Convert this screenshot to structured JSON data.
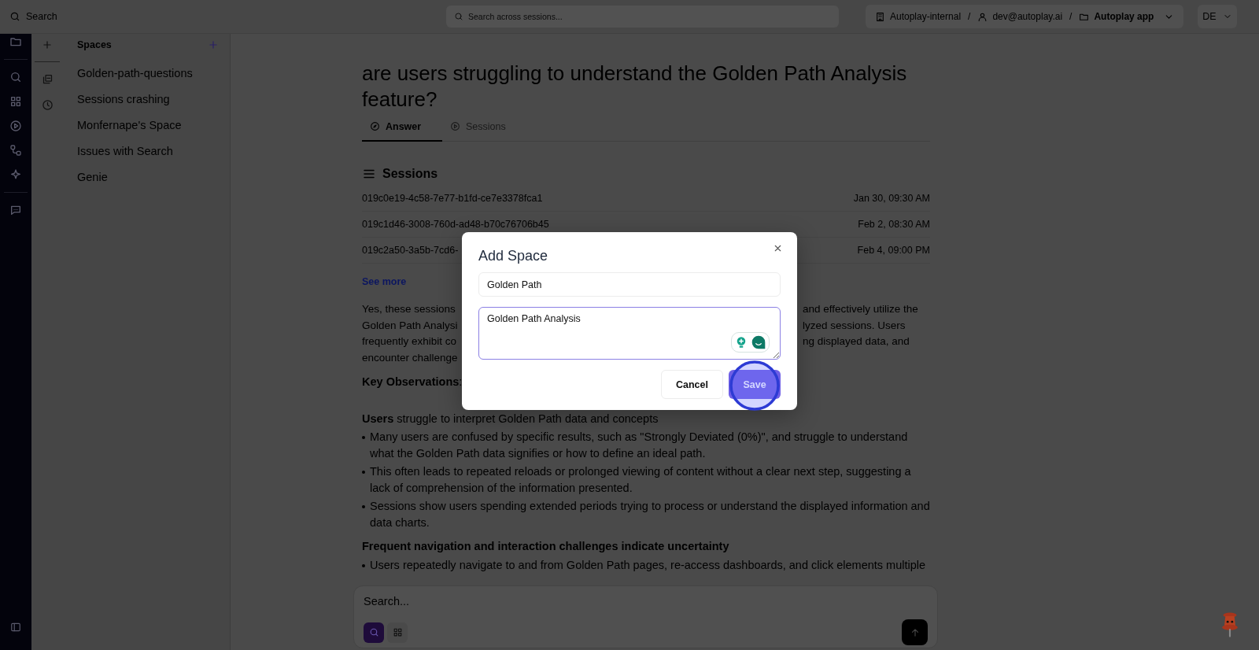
{
  "top_bar": {
    "search_label": "Search",
    "search_placeholder": "Search across sessions...",
    "breadcrumbs": [
      {
        "kind": "org",
        "label": "Autoplay-internal",
        "separator": "/"
      },
      {
        "kind": "user",
        "label": "dev@autoplay.ai",
        "separator": "/"
      },
      {
        "kind": "project",
        "label": "Autoplay app"
      }
    ],
    "language": "DE"
  },
  "spaces": {
    "title": "Spaces",
    "items": [
      "Golden-path-questions",
      "Sessions crashing",
      "Monfernape's Space",
      "Issues with Search",
      "Genie"
    ]
  },
  "main": {
    "question": "are users struggling to understand the Golden Path Analysis feature?",
    "tabs": [
      {
        "kind": "answer",
        "label": "Answer",
        "selected": true
      },
      {
        "kind": "sessions",
        "label": "Sessions",
        "selected": false
      }
    ],
    "sessions": {
      "title": "Sessions",
      "rows": [
        {
          "id": "019c0e19-4c58-7e77-b1fd-ce7e3378fca1",
          "date": "Jan 30, 09:30 AM"
        },
        {
          "id": "019c1d46-3008-760d-ad48-b70c76706b45",
          "date": "Feb 2, 08:30 AM"
        },
        {
          "id": "019c2a50-3a5b-7cd6-",
          "date": "Feb 4, 09:00 PM"
        }
      ],
      "see_more": "See more"
    },
    "answer": [
      {
        "kind": "split",
        "left": "Yes, these sessions",
        "right": "and effectively utilize the"
      },
      {
        "kind": "split",
        "left": "Golden Path Analysi",
        "right": "lyzed sessions. Users"
      },
      {
        "kind": "split",
        "left": "frequently exhibit co",
        "right": "ng displayed data, and"
      },
      {
        "kind": "split",
        "left": "encounter challenge"
      },
      {
        "kind": "para",
        "text": "**Key Observations**:"
      },
      {
        "kind": "para",
        "text": "**Users** struggle to interpret Golden Path data and concepts"
      },
      {
        "kind": "bullet",
        "text": "Many users are confused by specific results, such as \"Strongly Deviated (0%)\", and struggle to understand what the Golden Path data signifies or how to define an ideal path."
      },
      {
        "kind": "bullet",
        "text": "This often leads to repeated reloads or prolonged viewing of content without a clear next step, suggesting a lack of comprehension of the information presented."
      },
      {
        "kind": "bullet",
        "text": "Sessions show users spending extended periods trying to process or understand the displayed information and data charts."
      },
      {
        "kind": "heading",
        "text": "Frequent navigation and interaction challenges indicate uncertainty"
      },
      {
        "kind": "bullet",
        "text": "Users repeatedly navigate to and from Golden Path pages, re-access dashboards, and click elements multiple"
      }
    ]
  },
  "composer": {
    "placeholder": "Search...",
    "modes": [
      {
        "kind": "search",
        "selected": true
      },
      {
        "kind": "grid",
        "selected": false
      }
    ]
  },
  "modal": {
    "title": "Add Space",
    "name_value": "Golden Path",
    "description_value": "Golden Path Analysis",
    "buttons": [
      {
        "kind": "secondary",
        "label": "Cancel"
      },
      {
        "kind": "primary",
        "label": "Save"
      }
    ]
  }
}
